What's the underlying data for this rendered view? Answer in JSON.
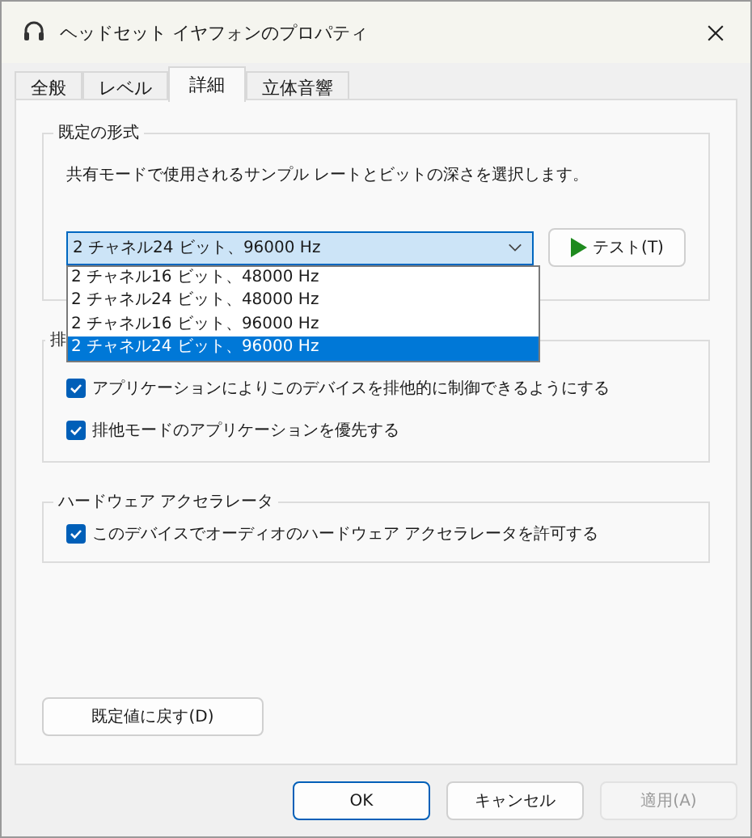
{
  "window": {
    "title": "ヘッドセット イヤフォンのプロパティ"
  },
  "tabs": [
    {
      "label": "全般",
      "selected": false
    },
    {
      "label": "レベル",
      "selected": false
    },
    {
      "label": "詳細",
      "selected": true
    },
    {
      "label": "立体音響",
      "selected": false
    }
  ],
  "default_format": {
    "title": "既定の形式",
    "description": "共有モードで使用されるサンプル レートとビットの深さを選択します。",
    "value": "2 チャネル24 ビット、96000 Hz",
    "expanded": true,
    "options": [
      {
        "label": "2 チャネル16 ビット、48000 Hz",
        "selected": false
      },
      {
        "label": "2 チャネル24 ビット、48000 Hz",
        "selected": false
      },
      {
        "label": "2 チャネル16 ビット、96000 Hz",
        "selected": false
      },
      {
        "label": "2 チャネル24 ビット、96000 Hz",
        "selected": true
      }
    ],
    "test_button": "テスト(T)"
  },
  "exclusive_mode": {
    "title": "排",
    "options": [
      {
        "label": "アプリケーションによりこのデバイスを排他的に制御できるようにする",
        "checked": true
      },
      {
        "label": "排他モードのアプリケーションを優先する",
        "checked": true
      }
    ]
  },
  "hardware_acceleration": {
    "title": "ハードウェア アクセラレータ",
    "options": [
      {
        "label": "このデバイスでオーディオのハードウェア アクセラレータを許可する",
        "checked": true
      }
    ]
  },
  "restore_button": "既定値に戻す(D)",
  "buttons": [
    {
      "label": "OK",
      "disabled": false,
      "default": true
    },
    {
      "label": "キャンセル",
      "disabled": false,
      "default": false
    },
    {
      "label": "適用(A)",
      "disabled": true,
      "default": false
    }
  ]
}
